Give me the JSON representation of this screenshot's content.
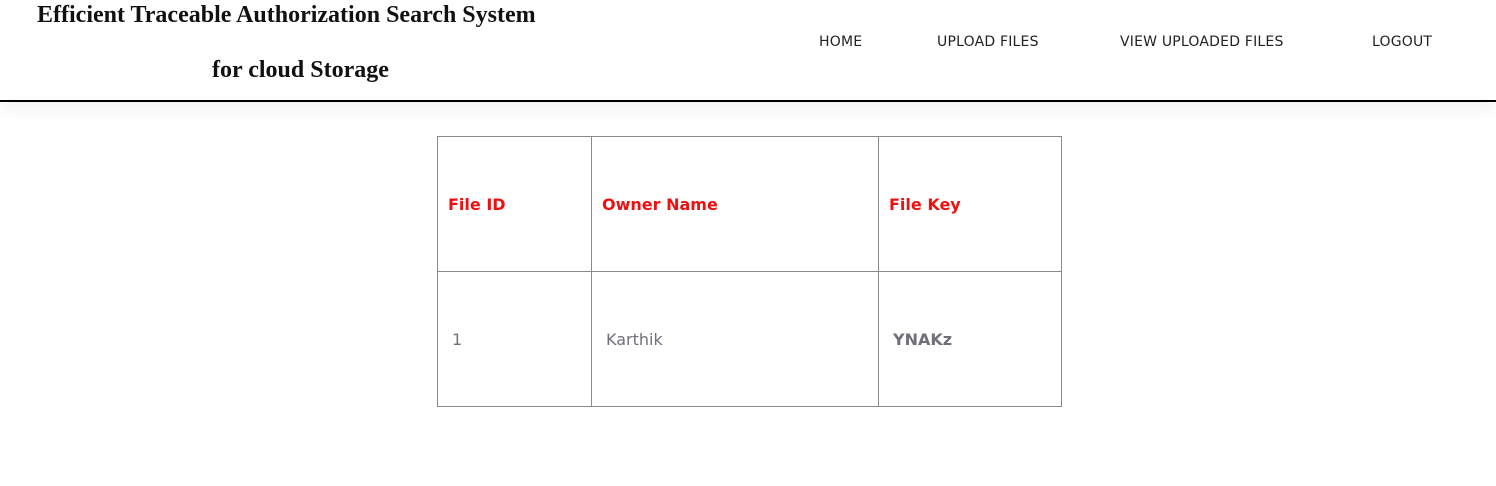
{
  "header": {
    "title_line1": "Efficient Traceable Authorization Search System",
    "title_line2": "for cloud Storage"
  },
  "nav": {
    "home": "HOME",
    "upload_files": "UPLOAD FILES",
    "view_uploaded_files": "VIEW UPLOADED FILES",
    "logout": "LOGOUT"
  },
  "table": {
    "headers": [
      "File ID",
      "Owner Name",
      "File Key"
    ],
    "rows": [
      [
        "1",
        "Karthik",
        "YNAKz"
      ]
    ]
  },
  "colors": {
    "header_text": "#ee1111",
    "cell_text": "#6f6f78",
    "border": "#8a8a8a"
  }
}
